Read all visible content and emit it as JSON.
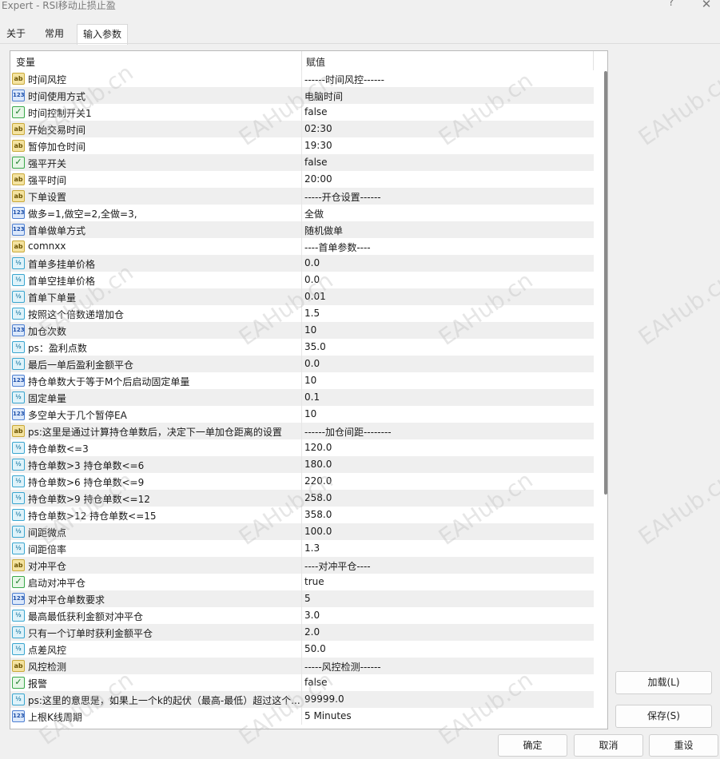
{
  "window": {
    "title": "Expert - RSI移动止损止盈",
    "help_label": "?",
    "close_label": "✕"
  },
  "tabs": [
    {
      "label": "关于"
    },
    {
      "label": "常用"
    },
    {
      "label": "输入参数"
    }
  ],
  "table": {
    "col_name": "变量",
    "col_value": "赋值",
    "rows": [
      {
        "type": "ab",
        "name": "时间风控",
        "value": "------时间风控------"
      },
      {
        "type": "int",
        "name": "时间使用方式",
        "value": "电脑时间"
      },
      {
        "type": "bool",
        "name": "时间控制开关1",
        "value": "false"
      },
      {
        "type": "ab",
        "name": "开始交易时间",
        "value": "02:30"
      },
      {
        "type": "ab",
        "name": "暂停加仓时间",
        "value": "19:30"
      },
      {
        "type": "bool",
        "name": "强平开关",
        "value": "false"
      },
      {
        "type": "ab",
        "name": "强平时间",
        "value": "20:00"
      },
      {
        "type": "ab",
        "name": "下单设置",
        "value": "-----开仓设置------"
      },
      {
        "type": "int",
        "name": "做多=1,做空=2,全做=3,",
        "value": "全做"
      },
      {
        "type": "int",
        "name": "首单做单方式",
        "value": "随机做单"
      },
      {
        "type": "ab",
        "name": "comnxx",
        "value": "----首单参数----"
      },
      {
        "type": "dbl",
        "name": "首单多挂单价格",
        "value": "0.0"
      },
      {
        "type": "dbl",
        "name": "首单空挂单价格",
        "value": "0.0"
      },
      {
        "type": "dbl",
        "name": "首单下单量",
        "value": "0.01"
      },
      {
        "type": "dbl",
        "name": "按照这个倍数递增加仓",
        "value": "1.5"
      },
      {
        "type": "int",
        "name": "加仓次数",
        "value": "10"
      },
      {
        "type": "dbl",
        "name": "ps：盈利点数",
        "value": "35.0"
      },
      {
        "type": "dbl",
        "name": "最后一单后盈利金额平仓",
        "value": "0.0"
      },
      {
        "type": "int",
        "name": "持仓单数大于等于M个后启动固定单量",
        "value": "10"
      },
      {
        "type": "dbl",
        "name": "固定单量",
        "value": "0.1"
      },
      {
        "type": "int",
        "name": "多空单大于几个暂停EA",
        "value": "10"
      },
      {
        "type": "ab",
        "name": "ps:这里是通过计算持仓单数后，决定下一单加仓距离的设置",
        "value": "------加仓间距--------"
      },
      {
        "type": "dbl",
        "name": "持仓单数<=3",
        "value": "120.0"
      },
      {
        "type": "dbl",
        "name": "持仓单数>3    持仓单数<=6",
        "value": "180.0"
      },
      {
        "type": "dbl",
        "name": "持仓单数>6    持仓单数<=9",
        "value": "220.0"
      },
      {
        "type": "dbl",
        "name": "持仓单数>9    持仓单数<=12",
        "value": "258.0"
      },
      {
        "type": "dbl",
        "name": "持仓单数>12   持仓单数<=15",
        "value": "358.0"
      },
      {
        "type": "dbl",
        "name": "间距微点",
        "value": "100.0"
      },
      {
        "type": "dbl",
        "name": "间距倍率",
        "value": "1.3"
      },
      {
        "type": "ab",
        "name": "对冲平仓",
        "value": "----对冲平仓----"
      },
      {
        "type": "bool",
        "name": "启动对冲平仓",
        "value": "true"
      },
      {
        "type": "int",
        "name": "对冲平仓单数要求",
        "value": "5"
      },
      {
        "type": "dbl",
        "name": "最高最低获利金额对冲平仓",
        "value": "3.0"
      },
      {
        "type": "dbl",
        "name": "只有一个订单时获利金额平仓",
        "value": "2.0"
      },
      {
        "type": "dbl",
        "name": "点差风控",
        "value": "50.0"
      },
      {
        "type": "ab",
        "name": "风控检测",
        "value": "-----风控检测------"
      },
      {
        "type": "bool",
        "name": "报警",
        "value": "false"
      },
      {
        "type": "dbl",
        "name": "ps:这里的意思是，如果上一个k的起伏（最高-最低）超过这个...",
        "value": "99999.0"
      },
      {
        "type": "int",
        "name": "上根K线周期",
        "value": "5 Minutes"
      }
    ]
  },
  "icons": {
    "ab": "ab",
    "int": "123",
    "dbl": "½",
    "bool": "✓"
  },
  "buttons": {
    "load": "加载(L)",
    "save": "保存(S)",
    "ok": "确定",
    "cancel": "取消",
    "reset": "重设"
  },
  "watermark_text": "EAHub.cn"
}
